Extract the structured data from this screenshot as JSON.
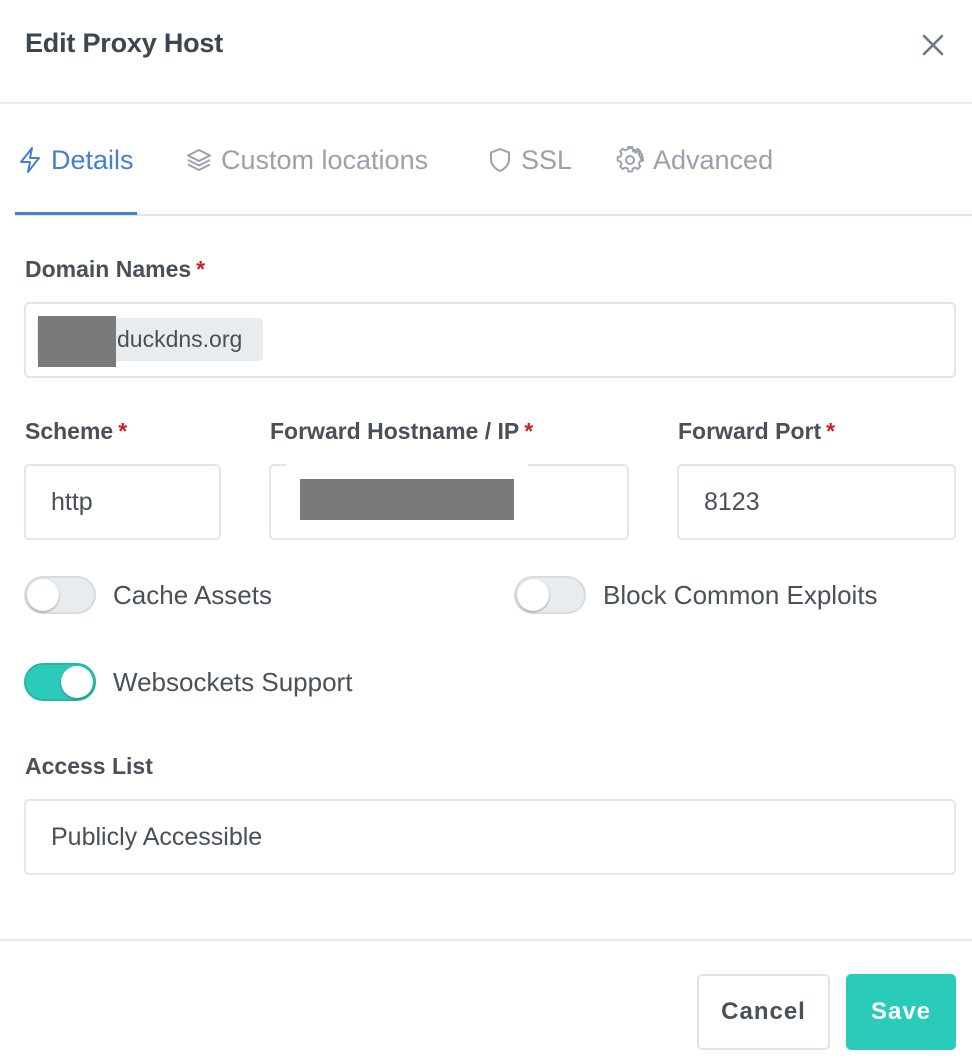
{
  "modal": {
    "title": "Edit Proxy Host",
    "close_icon": "close-icon"
  },
  "tabs": [
    {
      "label": "Details",
      "icon": "zap-icon",
      "active": true
    },
    {
      "label": "Custom locations",
      "icon": "layers-icon",
      "active": false
    },
    {
      "label": "SSL",
      "icon": "shield-icon",
      "active": false
    },
    {
      "label": "Advanced",
      "icon": "gear-icon",
      "active": false
    }
  ],
  "form": {
    "domain_names": {
      "label": "Domain Names",
      "required_mark": "*",
      "chips": [
        {
          "value": "duckdns.org",
          "redacted_prefix": true
        }
      ]
    },
    "scheme": {
      "label": "Scheme",
      "required_mark": "*",
      "value": "http"
    },
    "forward_host": {
      "label": "Forward Hostname / IP",
      "required_mark": "*",
      "value": "[redacted]"
    },
    "forward_port": {
      "label": "Forward Port",
      "required_mark": "*",
      "value": "8123"
    },
    "toggles": [
      {
        "label": "Cache Assets",
        "checked": false
      },
      {
        "label": "Block Common Exploits",
        "checked": false
      },
      {
        "label": "Websockets Support",
        "checked": true
      }
    ],
    "access_list": {
      "label": "Access List",
      "value": "Publicly Accessible"
    }
  },
  "footer": {
    "cancel_label": "Cancel",
    "save_label": "Save"
  },
  "colors": {
    "accent_blue": "#467fcf",
    "teal": "#2bcbba",
    "required_red": "#cd201f"
  }
}
